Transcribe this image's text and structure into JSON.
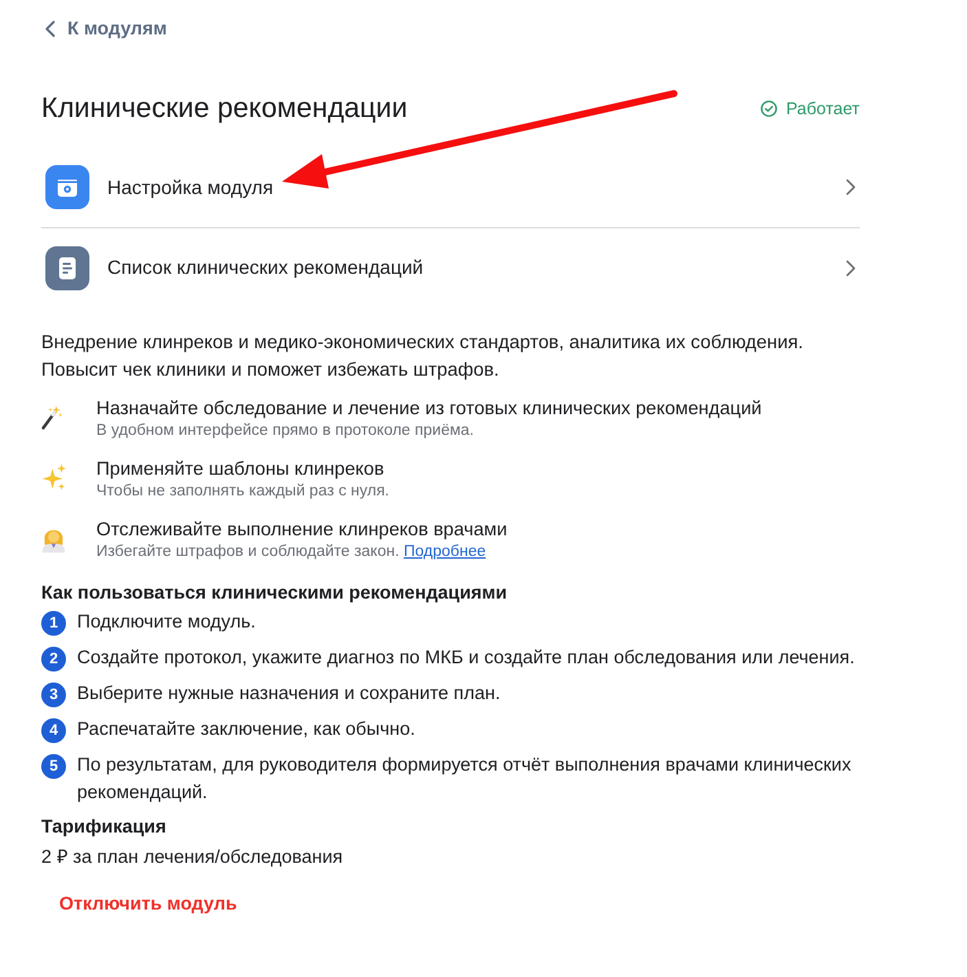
{
  "back_link": {
    "label": "К модулям"
  },
  "header": {
    "title": "Клинические рекомендации",
    "status": {
      "kind": "working",
      "label": "Работает"
    }
  },
  "menu": [
    {
      "kind": "settings",
      "label": "Настройка модуля"
    },
    {
      "kind": "list",
      "label": "Список клинических рекомендаций"
    }
  ],
  "description": [
    "Внедрение клинреков и медико-экономических стандартов, аналитика их соблюдения.",
    "Повысит чек клиники и поможет избежать штрафов."
  ],
  "features": [
    {
      "kind": "wand",
      "title": "Назначайте обследование и лечение из готовых клинических рекомендаций",
      "subtitle": "В удобном интерфейсе прямо в протоколе приёма."
    },
    {
      "kind": "sparkles",
      "title": "Применяйте шаблоны клинреков",
      "subtitle": "Чтобы не заполнять каждый раз с нуля."
    },
    {
      "kind": "doctor",
      "title": "Отслеживайте выполнение клинреков врачами",
      "subtitle": "Избегайте штрафов и соблюдайте закон.",
      "link": "Подробнее"
    }
  ],
  "how_to": {
    "title": "Как пользоваться клиническими рекомендациями",
    "steps": [
      {
        "number": "1",
        "text": "Подключите модуль."
      },
      {
        "number": "2",
        "text": "Создайте протокол, укажите диагноз по МКБ и создайте план обследования или лечения."
      },
      {
        "number": "3",
        "text": "Выберите нужные назначения и сохраните план."
      },
      {
        "number": "4",
        "text": "Распечатайте заключение, как обычно."
      },
      {
        "number": "5",
        "text": "По результатам, для руководителя формируется отчёт выполнения врачами клинических рекомендаций."
      }
    ]
  },
  "pricing": {
    "title": "Тарификация",
    "text": "2 ₽ за план лечения/обследования"
  },
  "disable_button": {
    "label": "Отключить модуль"
  },
  "annotations": [
    {
      "kind": "arrow"
    }
  ]
}
